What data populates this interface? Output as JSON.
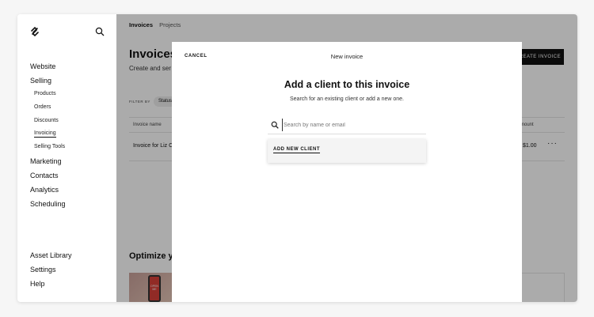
{
  "sidebar": {
    "items": [
      {
        "label": "Website"
      },
      {
        "label": "Selling"
      }
    ],
    "selling_sub": [
      {
        "label": "Products"
      },
      {
        "label": "Orders"
      },
      {
        "label": "Discounts"
      },
      {
        "label": "Invoicing",
        "active": true
      },
      {
        "label": "Selling Tools"
      }
    ],
    "items_after": [
      {
        "label": "Marketing"
      },
      {
        "label": "Contacts"
      },
      {
        "label": "Analytics"
      },
      {
        "label": "Scheduling"
      }
    ],
    "bottom": [
      {
        "label": "Asset Library"
      },
      {
        "label": "Settings"
      },
      {
        "label": "Help"
      }
    ]
  },
  "main": {
    "tabs": [
      {
        "label": "Invoices",
        "active": true
      },
      {
        "label": "Projects"
      }
    ],
    "title": "Invoices",
    "subtitle": "Create and ser",
    "create_label": "CREATE INVOICE",
    "filter_label": "FILTER BY",
    "filter_chip": "Status",
    "col_name": "Invoice name",
    "col_amount": "Amount",
    "row": {
      "name": "Invoice for Liz C",
      "amount": "$1.00",
      "more": "···"
    },
    "optimize": "Optimize y",
    "promo_phone_text": "OPEN ME"
  },
  "modal": {
    "cancel_label": "CANCEL",
    "title": "New invoice",
    "heading": "Add a client to this invoice",
    "subtext": "Search for an existing client or add a new one.",
    "search_placeholder": "Search by name or email",
    "search_value": "",
    "add_client_label": "ADD NEW CLIENT"
  }
}
